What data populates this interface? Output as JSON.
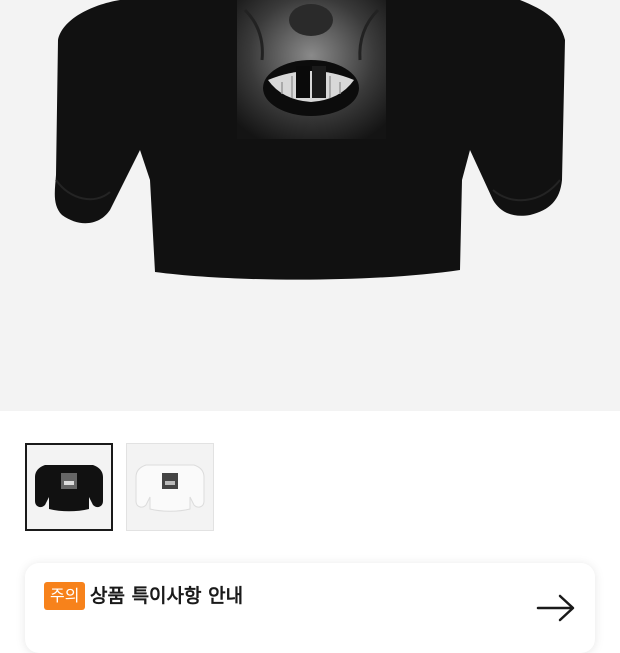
{
  "product_gallery": {
    "main_image_alt": "",
    "thumbnails": [
      {
        "variant": "black",
        "selected": true
      },
      {
        "variant": "white",
        "selected": false
      }
    ]
  },
  "notice": {
    "badge": "주의",
    "title": "상품 특이사항 안내",
    "subtitle": "",
    "arrow_icon": "arrow-right-icon"
  },
  "colors": {
    "hero_bg": "#f3f3f3",
    "badge_bg": "#f7821b",
    "selected_border": "#1a1a1a"
  }
}
